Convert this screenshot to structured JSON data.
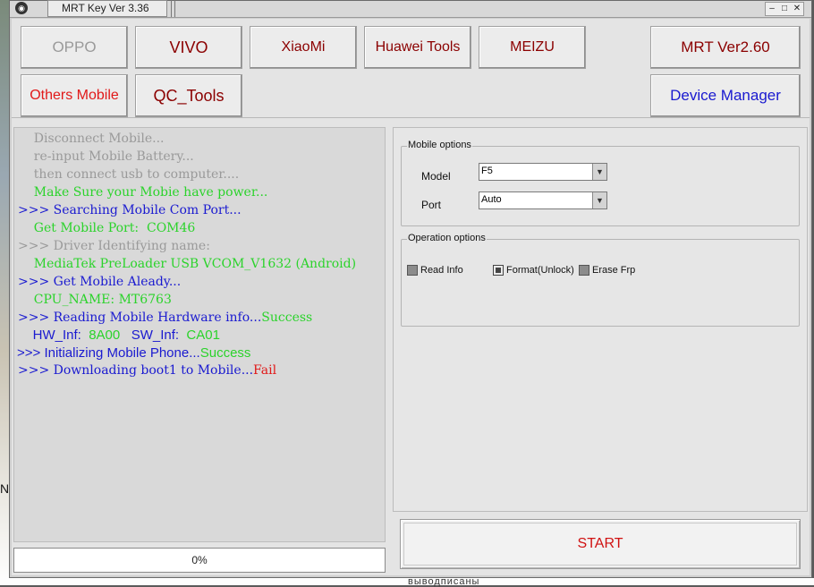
{
  "window": {
    "title": "MRT Key Ver 3.36",
    "controls": [
      "‒",
      "□",
      "✕"
    ]
  },
  "brands": {
    "oppo": "OPPO",
    "vivo": "VIVO",
    "xiaomi": "XiaoMi",
    "huawei": "Huawei Tools",
    "meizu": "MEIZU",
    "mrt": "MRT Ver2.60",
    "others": "Others Mobile",
    "qc": "QC_Tools",
    "device_manager": "Device Manager"
  },
  "log": {
    "l1": "    Disconnect Mobile...",
    "l2": "    re-input Mobile Battery...",
    "l3": "    then connect usb to computer....",
    "l4": "    Make Sure your Mobie have power...",
    "l5": ">>> Searching Mobile Com Port...",
    "l6": "    Get Mobile Port:  COM46",
    "l7": ">>> Driver Identifying name:",
    "l8": "    MediaTek PreLoader USB VCOM_V1632 (Android)",
    "l9": ">>> Get Mobile Aleady...",
    "l10": "    CPU_NAME: MT6763",
    "l11a": ">>> Reading Mobile Hardware info...",
    "l11b": "Success",
    "l12a": "    HW_Inf:  ",
    "l12b": "8A00",
    "l12c": "   SW_Inf:  ",
    "l12d": "CA01",
    "l13a": ">>> Initializing Mobile Phone...",
    "l13b": "Success",
    "l14a": ">>> Downloading boot1 to Mobile...",
    "l14b": "Fail"
  },
  "progress": {
    "value": "0%",
    "fraction": 0
  },
  "mobile_options": {
    "title": "Mobile options",
    "model_label": "Model",
    "model_value": "F5",
    "port_label": "Port",
    "port_value": "Auto"
  },
  "operation_options": {
    "title": "Operation options",
    "read_info": "Read Info",
    "format_unlock": "Format(Unlock)",
    "erase_frp": "Erase Frp"
  },
  "start_label": "START",
  "background": {
    "left_letter": "N",
    "bottom_text": "выводписаны"
  },
  "colors": {
    "brand_text": "#8b0000",
    "others_text": "#e11919",
    "device_manager_text": "#1a1ad0",
    "oppo_disabled": "#9a9a9a",
    "log_green": "#2bd32b",
    "log_blue": "#1a1ad0",
    "log_gray": "#9a9a9a",
    "log_red": "#e11919"
  }
}
